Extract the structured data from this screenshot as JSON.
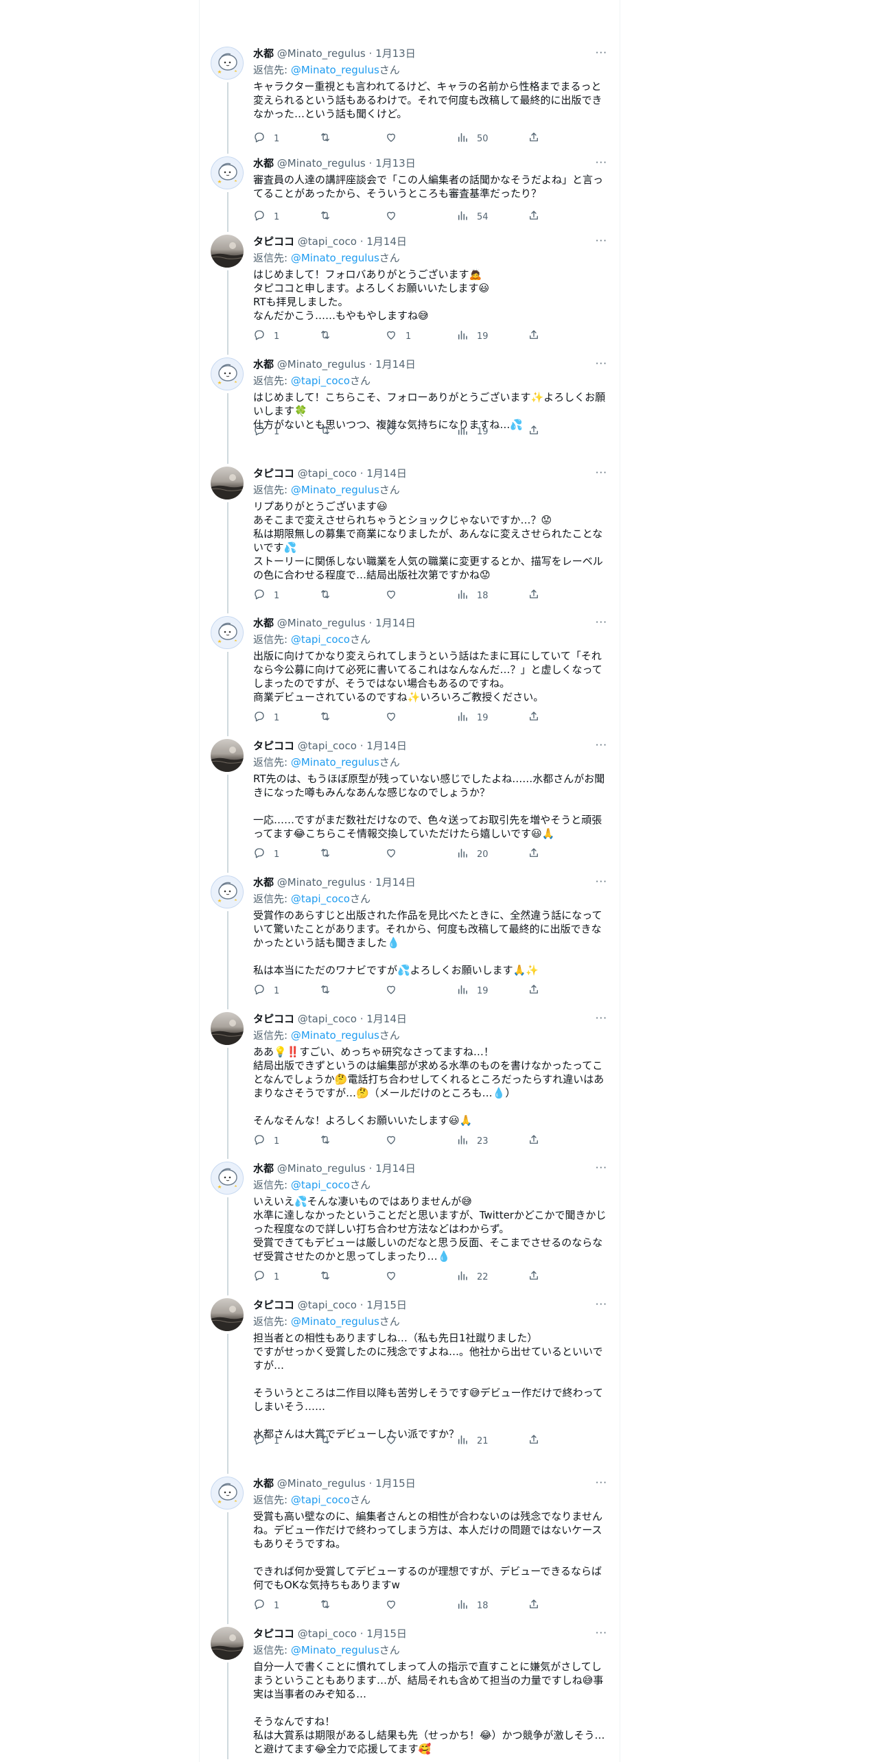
{
  "users": {
    "minato": {
      "name": "水都",
      "handle": "@Minato_regulus",
      "reply_handle": "@Minato_regulus"
    },
    "tapi": {
      "name": "タピココ",
      "handle": "@tapi_coco",
      "reply_handle": "@tapi_coco"
    }
  },
  "labels": {
    "reply_prefix": "返信先: ",
    "reply_suffix": "さん",
    "more": "···",
    "dot": " · "
  },
  "tweets": [
    {
      "user": "minato",
      "name": "水都",
      "handle": "@Minato_regulus",
      "date": "1月13日",
      "reply_to": "@Minato_regulus",
      "text": "キャラクター重視とも言われてるけど、キャラの名前から性格までまるっと変えられるという話もあるわけで。それで何度も改稿して最終的に出版できなかった…という話も聞くけど。",
      "replies": "1",
      "retweets": "",
      "likes": "",
      "views": "50"
    },
    {
      "user": "minato",
      "name": "水都",
      "handle": "@Minato_regulus",
      "date": "1月13日",
      "reply_to": "",
      "text": "審査員の人達の講評座談会で「この人編集者の話聞かなそうだよね」と言ってることがあったから、そういうところも審査基準だったり？",
      "replies": "1",
      "retweets": "",
      "likes": "",
      "views": "54"
    },
    {
      "user": "tapi",
      "name": "タピココ",
      "handle": "@tapi_coco",
      "date": "1月14日",
      "reply_to": "@Minato_regulus",
      "text": "はじめまして！フォロバありがとうございます🙇\nタピココと申します。よろしくお願いいたします😃\nRTも拝見しました。\nなんだかこう……もやもやしますね😅",
      "replies": "1",
      "retweets": "",
      "likes": "1",
      "views": "19"
    },
    {
      "user": "minato",
      "name": "水都",
      "handle": "@Minato_regulus",
      "date": "1月14日",
      "reply_to": "@tapi_coco",
      "text": "はじめまして！こちらこそ、フォローありがとうございます✨よろしくお願いします🍀\n仕方がないとも思いつつ、複雑な気持ちになりますね…💦",
      "replies": "1",
      "retweets": "",
      "likes": "",
      "views": "19"
    },
    {
      "user": "tapi",
      "name": "タピココ",
      "handle": "@tapi_coco",
      "date": "1月14日",
      "reply_to": "@Minato_regulus",
      "text": "リプありがとうございます😃\nあそこまで変えさせられちゃうとショックじゃないですか…？😟\n私は期限無しの募集で商業になりましたが、あんなに変えさせられたことないです💦\nストーリーに関係しない職業を人気の職業に変更するとか、描写をレーベルの色に合わせる程度で…結局出版社次第ですかね😟",
      "replies": "1",
      "retweets": "",
      "likes": "",
      "views": "18"
    },
    {
      "user": "minato",
      "name": "水都",
      "handle": "@Minato_regulus",
      "date": "1月14日",
      "reply_to": "@tapi_coco",
      "text": "出版に向けてかなり変えられてしまうという話はたまに耳にしていて「それなら今公募に向けて必死に書いてるこれはなんなんだ…？」と虚しくなってしまったのですが、そうではない場合もあるのですね。\n商業デビューされているのですね✨いろいろご教授ください。",
      "replies": "1",
      "retweets": "",
      "likes": "",
      "views": "19"
    },
    {
      "user": "tapi",
      "name": "タピココ",
      "handle": "@tapi_coco",
      "date": "1月14日",
      "reply_to": "@Minato_regulus",
      "text": "RT先のは、もうほぼ原型が残っていない感じでしたよね……水都さんがお聞きになった噂もみんなあんな感じなのでしょうか？\n\n一応……ですがまだ数社だけなので、色々送ってお取引先を増やそうと頑張ってます😂こちらこそ情報交換していただけたら嬉しいです😃🙏",
      "replies": "1",
      "retweets": "",
      "likes": "",
      "views": "20"
    },
    {
      "user": "minato",
      "name": "水都",
      "handle": "@Minato_regulus",
      "date": "1月14日",
      "reply_to": "@tapi_coco",
      "text": "受賞作のあらすじと出版された作品を見比べたときに、全然違う話になっていて驚いたことがあります。それから、何度も改稿して最終的に出版できなかったという話も聞きました💧\n\n私は本当にただのワナビですが💦よろしくお願いします🙏✨",
      "replies": "1",
      "retweets": "",
      "likes": "",
      "views": "19"
    },
    {
      "user": "tapi",
      "name": "タピココ",
      "handle": "@tapi_coco",
      "date": "1月14日",
      "reply_to": "@Minato_regulus",
      "text": "ああ💡‼️すごい、めっちゃ研究なさってますね…！\n結局出版できずというのは編集部が求める水準のものを書けなかったってことなんでしょうか🤔電話打ち合わせしてくれるところだったらすれ違いはあまりなさそうですが…🤔（メールだけのところも…💧）\n\nそんなそんな！よろしくお願いいたします😃🙏",
      "replies": "1",
      "retweets": "",
      "likes": "",
      "views": "23"
    },
    {
      "user": "minato",
      "name": "水都",
      "handle": "@Minato_regulus",
      "date": "1月14日",
      "reply_to": "@tapi_coco",
      "text": "いえいえ💦そんな凄いものではありませんが😅\n水準に達しなかったということだと思いますが、Twitterかどこかで聞きかじった程度なので詳しい打ち合わせ方法などはわからず。\n受賞できてもデビューは厳しいのだなと思う反面、そこまでさせるのならなぜ受賞させたのかと思ってしまったり…💧",
      "replies": "1",
      "retweets": "",
      "likes": "",
      "views": "22"
    },
    {
      "user": "tapi",
      "name": "タピココ",
      "handle": "@tapi_coco",
      "date": "1月15日",
      "reply_to": "@Minato_regulus",
      "text": "担当者との相性もありますしね…（私も先日1社蹴りました）\nですがせっかく受賞したのに残念ですよね…。他社から出せているといいですが…\n\nそういうところは二作目以降も苦労しそうです😅デビュー作だけで終わってしまいそう……\n\n水都さんは大賞でデビューしたい派ですか？",
      "replies": "1",
      "retweets": "",
      "likes": "",
      "views": "21"
    },
    {
      "user": "minato",
      "name": "水都",
      "handle": "@Minato_regulus",
      "date": "1月15日",
      "reply_to": "@tapi_coco",
      "text": "受賞も高い壁なのに、編集者さんとの相性が合わないのは残念でなりませんね。デビュー作だけで終わってしまう方は、本人だけの問題ではないケースもありそうですね。\n\nできれば何か受賞してデビューするのが理想ですが、デビューできるならば何でもOKな気持ちもありますw",
      "replies": "1",
      "retweets": "",
      "likes": "",
      "views": "18"
    },
    {
      "user": "tapi",
      "name": "タピココ",
      "handle": "@tapi_coco",
      "date": "1月15日",
      "reply_to": "@Minato_regulus",
      "text": "自分一人で書くことに慣れてしまって人の指示で直すことに嫌気がさしてしまうということもあります…が、結局それも含めて担当の力量ですしね😅事実は当事者のみぞ知る…\n\nそうなんですね！\n私は大賞系は期限があるし結果も先（せっかち！😂）かつ競争が激しそう…と避けてます😂全力で応援してます🥰",
      "replies": "",
      "retweets": "",
      "likes": "",
      "views": ""
    }
  ]
}
